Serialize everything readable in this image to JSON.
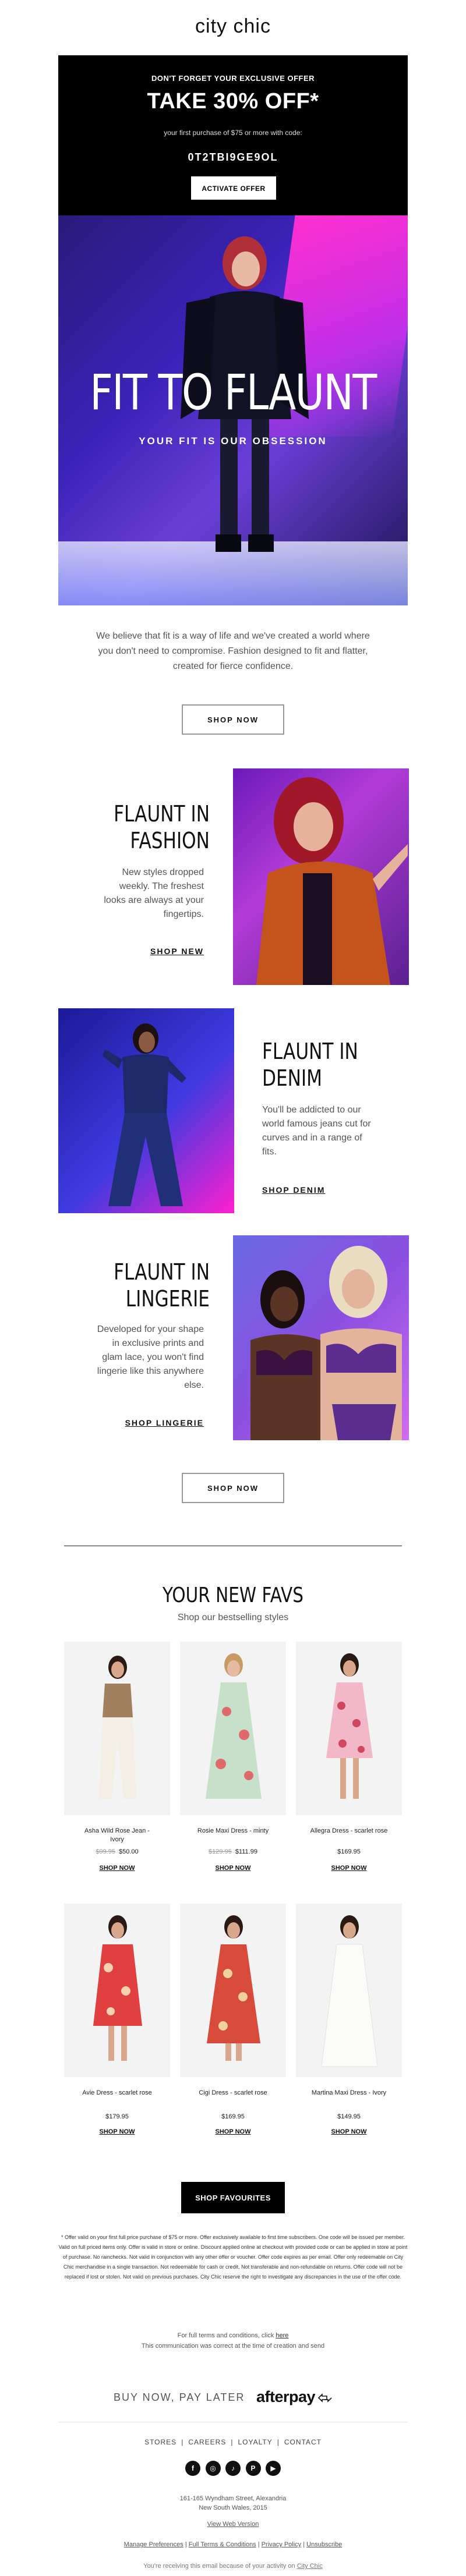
{
  "brand": {
    "logo": "city chic"
  },
  "offer": {
    "eyebrow": "DON'T FORGET YOUR EXCLUSIVE OFFER",
    "headline": "TAKE 30% OFF*",
    "sub": "your first purchase of $75 or more with code:",
    "code": "0T2TBI9GE9OL",
    "button": "ACTIVATE OFFER"
  },
  "hero": {
    "title": "FIT TO FLAUNT",
    "tagline": "YOUR FIT IS OUR OBSESSION"
  },
  "intro": {
    "text": "We believe that fit is a way of life and we've created a world where you don't need to compromise. Fashion designed to fit and flatter, created for fierce confidence.",
    "button": "SHOP NOW"
  },
  "features": [
    {
      "title_1": "FLAUNT IN",
      "title_2": "FASHION",
      "body": "New styles dropped weekly. The freshest looks are always at your fingertips.",
      "link": "SHOP NEW"
    },
    {
      "title_1": "FLAUNT IN",
      "title_2": "DENIM",
      "body": "You'll be addicted to our world famous jeans cut for curves and in a range of fits.",
      "link": "SHOP DENIM"
    },
    {
      "title_1": "FLAUNT IN",
      "title_2": "LINGERIE",
      "body": "Developed for your shape in exclusive prints and glam lace, you won't find lingerie like this anywhere else.",
      "link": "SHOP LINGERIE"
    }
  ],
  "shop_now_2": "SHOP NOW",
  "favs": {
    "title": "YOUR NEW FAVS",
    "subtitle": "Shop our bestselling styles",
    "products": [
      {
        "name_1": "Asha Wild Rose Jean -",
        "name_2": "Ivory",
        "was": "$99.95",
        "price": "$50.00",
        "link": "SHOP NOW"
      },
      {
        "name_1": "Rosie Maxi Dress - minty",
        "name_2": "",
        "was": "$129.95",
        "price": "$111.99",
        "link": "SHOP NOW"
      },
      {
        "name_1": "Allegra Dress - scarlet rose",
        "name_2": "",
        "was": "",
        "price": "$169.95",
        "link": "SHOP NOW"
      },
      {
        "name_1": "Avie Dress - scarlet rose",
        "name_2": "",
        "was": "",
        "price": "$179.95",
        "link": "SHOP NOW"
      },
      {
        "name_1": "Cigi Dress - scarlet rose",
        "name_2": "",
        "was": "",
        "price": "$169.95",
        "link": "SHOP NOW"
      },
      {
        "name_1": "Martina Maxi Dress - Ivory",
        "name_2": "",
        "was": "",
        "price": "$149.95",
        "link": "SHOP NOW"
      }
    ],
    "button": "SHOP FAVOURITES"
  },
  "disclaimer": "* Offer valid on your first full price purchase of $75 or more. Offer exclusively available to first time subscribers. One code will be issued per member. Valid on full priced items only. Offer is valid in store or online. Discount applied online at checkout with provided code or can be applied in store at point of purchase. No rainchecks. Not valid in conjunction with any other offer or voucher. Offer code expires as per email. Offer only redeemable on City Chic merchandise in a single transaction. Not redeemable for cash or credit. Not transferable and non-refundable on returns. Offer code will not be replaced if lost or stolen. Not valid on previous purchases. City Chic reserve the right to investigate any discrepancies in the use of the offer code.",
  "terms": {
    "line1_prefix": "For full terms and conditions, click ",
    "line1_link": "here",
    "line2": "This communication was correct at the time of creation and send"
  },
  "afterpay": {
    "bnpl": "BUY NOW, PAY LATER",
    "logo": "afterpay"
  },
  "footer": {
    "nav": [
      "STORES",
      "CAREERS",
      "LOYALTY",
      "CONTACT"
    ],
    "socials": [
      {
        "icon": "facebook-icon",
        "glyph": "f"
      },
      {
        "icon": "instagram-icon",
        "glyph": "◎"
      },
      {
        "icon": "tiktok-icon",
        "glyph": "♪"
      },
      {
        "icon": "pinterest-icon",
        "glyph": "P"
      },
      {
        "icon": "youtube-icon",
        "glyph": "▶"
      }
    ],
    "address_1": "161-165 Wyndham Street, Alexandria",
    "address_2": "New South Wales, 2015",
    "web_version": "View Web Version",
    "prefs": [
      "Manage Preferences",
      "Full Terms & Conditions",
      "Privacy Policy",
      "Unsubscribe"
    ],
    "receiving_prefix": "You're receiving this email because of your activity on ",
    "receiving_link": "City Chic"
  },
  "colors": {
    "offer_bg": "#000000",
    "button_dark": "#000000",
    "hero_pink": "#ff2fd0",
    "hero_blue": "#3b22b8"
  }
}
